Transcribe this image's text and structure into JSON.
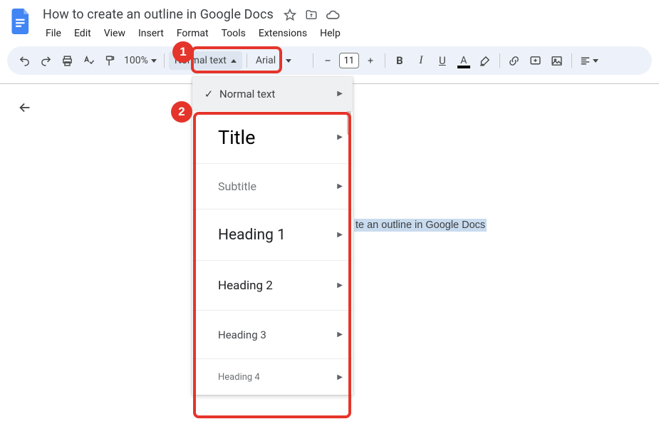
{
  "header": {
    "doc_title": "How to create an outline in Google Docs",
    "menu": [
      "File",
      "Edit",
      "View",
      "Insert",
      "Format",
      "Tools",
      "Extensions",
      "Help"
    ]
  },
  "toolbar": {
    "zoom": "100%",
    "style_label": "Normal text",
    "font_label": "Arial",
    "font_size": "11"
  },
  "style_menu": {
    "items": [
      {
        "label": "Normal text",
        "class": "normal",
        "selected": true
      },
      {
        "label": "Title",
        "class": "title",
        "selected": false
      },
      {
        "label": "Subtitle",
        "class": "subtitle",
        "selected": false
      },
      {
        "label": "Heading 1",
        "class": "h1",
        "selected": false
      },
      {
        "label": "Heading 2",
        "class": "h2",
        "selected": false
      },
      {
        "label": "Heading 3",
        "class": "h3",
        "selected": false
      },
      {
        "label": "Heading 4",
        "class": "h4",
        "selected": false
      }
    ]
  },
  "document": {
    "selected_text_fragment": "te an outline in Google Docs"
  },
  "annotations": {
    "callout_1": "1",
    "callout_2": "2"
  }
}
